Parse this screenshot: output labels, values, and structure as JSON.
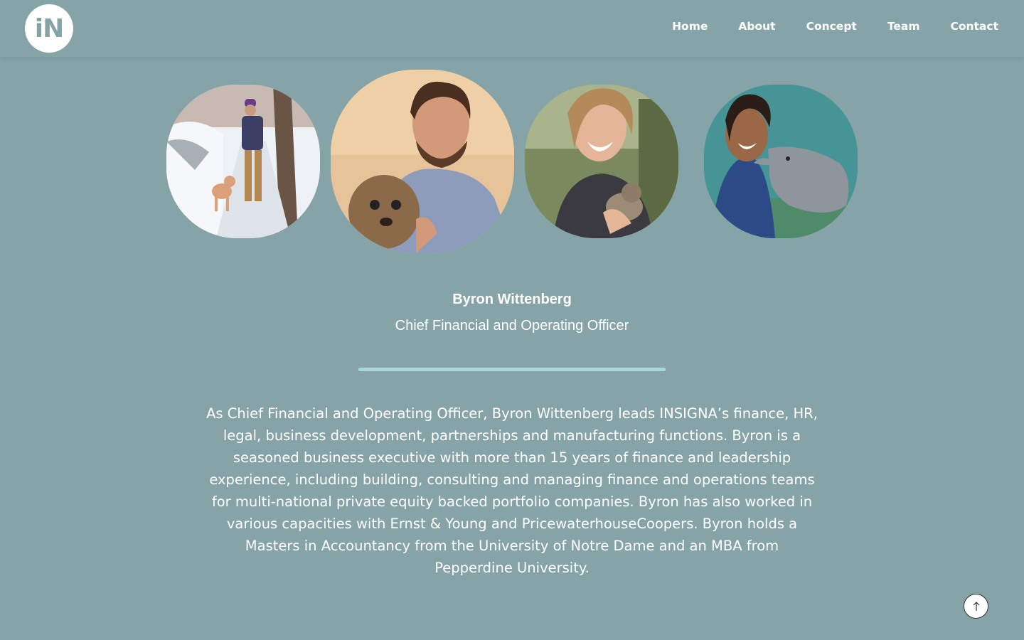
{
  "header": {
    "logo_text": "iN",
    "nav": [
      {
        "label": "Home"
      },
      {
        "label": "About"
      },
      {
        "label": "Concept"
      },
      {
        "label": "Team"
      },
      {
        "label": "Contact"
      }
    ]
  },
  "team_photos": [
    {
      "subject": "man-with-dog-in-snow"
    },
    {
      "subject": "man-holding-dog",
      "selected": true
    },
    {
      "subject": "woman-holding-kitten"
    },
    {
      "subject": "woman-with-dolphin"
    }
  ],
  "profile": {
    "name": "Byron Wittenberg",
    "role": "Chief Financial and Operating Officer",
    "bio": "As Chief Financial and Operating Officer, Byron Wittenberg leads INSIGNA’s finance, HR, legal, business development, partnerships and manufacturing functions. Byron is a seasoned business executive with more than 15 years of finance and leadership experience, including building, consulting and managing finance and operations teams for multi-national private equity backed portfolio companies. Byron has also worked in various capacities with Ernst & Young and PricewaterhouseCoopers. Byron holds a Masters in Accountancy from the University of Notre Dame and an MBA from Pepperdine University."
  },
  "colors": {
    "background": "#86a4a8",
    "divider": "#a9d8dc",
    "text": "#ffffff"
  },
  "icons": {
    "scroll_top": "arrow-up-icon"
  }
}
